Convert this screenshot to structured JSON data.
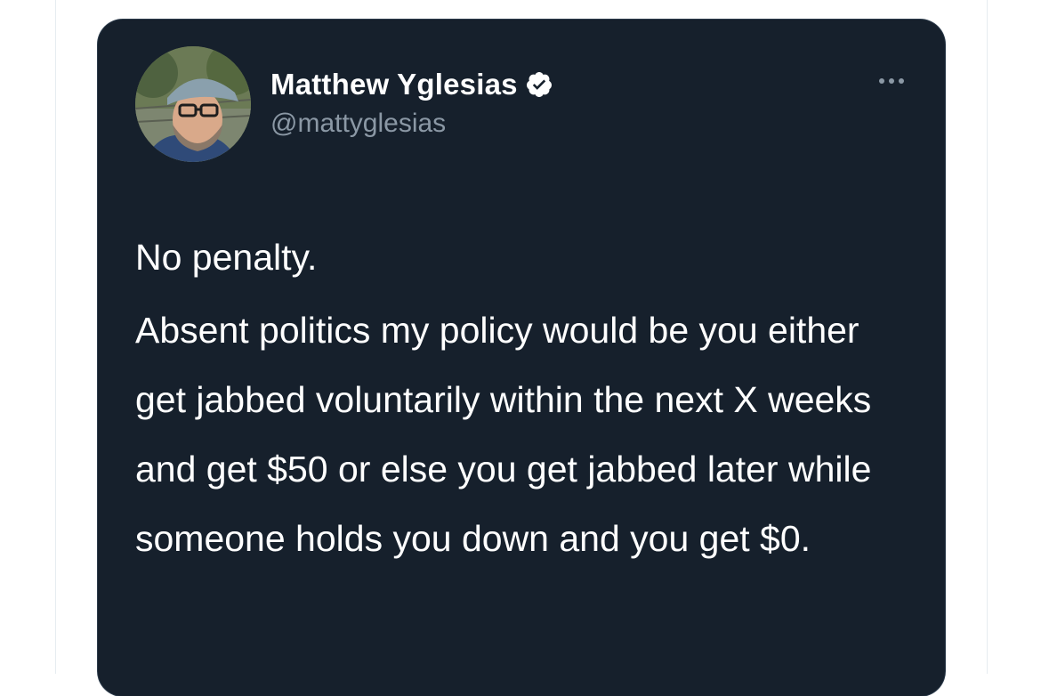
{
  "tweet": {
    "author_name": "Matthew Yglesias",
    "author_handle": "@mattyglesias",
    "verified_icon": "verified-badge-icon",
    "more_icon": "more-options-icon",
    "paragraphs": [
      "No penalty.",
      "Absent politics my policy would be you either get jabbed voluntarily within the next X weeks and get $50 or else you get jabbed later while someone holds you down and you get $0."
    ]
  },
  "colors": {
    "card_background": "#16202c",
    "text_primary": "#ffffff",
    "text_secondary": "#8b98a5",
    "page_background": "#ffffff"
  }
}
